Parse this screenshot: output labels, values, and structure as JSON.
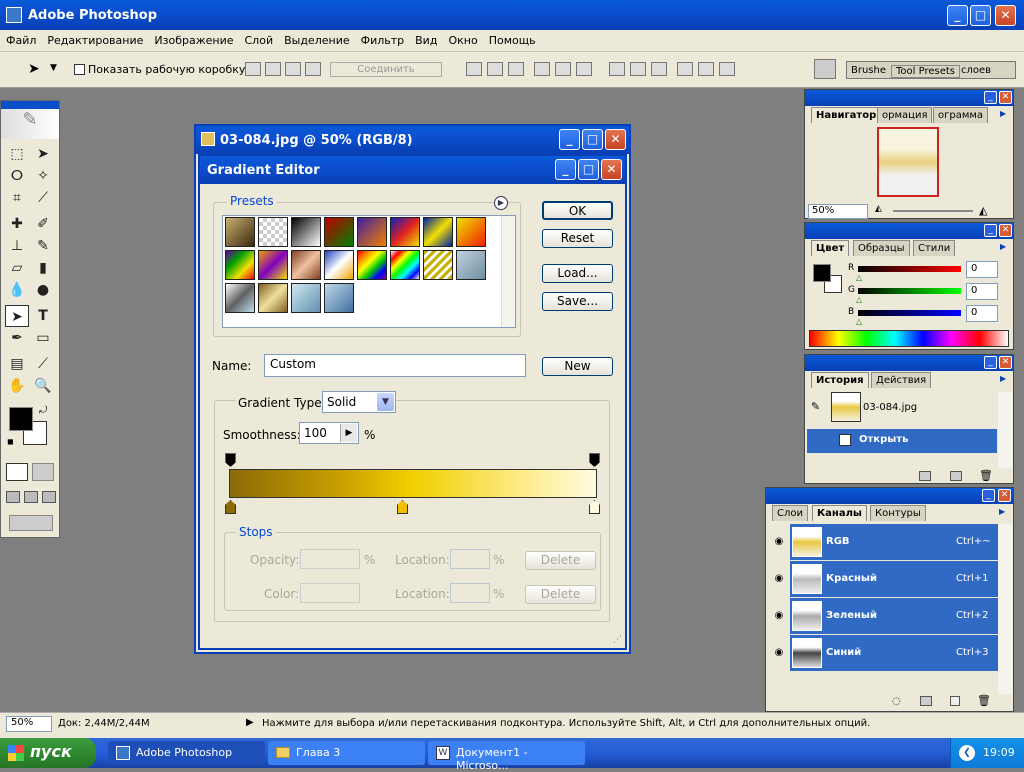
{
  "app": {
    "title": "Adobe Photoshop"
  },
  "menu": [
    "Файл",
    "Редактирование",
    "Изображение",
    "Слой",
    "Выделение",
    "Фильтр",
    "Вид",
    "Окно",
    "Помощь"
  ],
  "options": {
    "show_box_label": "Показать рабочую коробку",
    "merge_label": "Соединить",
    "palette_tabs": [
      "Brushe",
      "Tool Presets",
      "слоев"
    ]
  },
  "document": {
    "title": "03-084.jpg @ 50% (RGB/8)"
  },
  "gradient_editor": {
    "title": "Gradient Editor",
    "presets_label": "Presets",
    "buttons": {
      "ok": "OK",
      "reset": "Reset",
      "load": "Load...",
      "save": "Save...",
      "new": "New"
    },
    "name_label": "Name:",
    "name_value": "Custom",
    "type_label": "Gradient Type:",
    "type_value": "Solid",
    "smoothness_label": "Smoothness:",
    "smoothness_value": "100",
    "pct": "%",
    "stops_label": "Stops",
    "opacity_label": "Opacity:",
    "color_label": "Color:",
    "location_label": "Location:",
    "delete_label": "Delete",
    "gradient_colors": [
      "#8b6a08",
      "#c8a000",
      "#f0d000",
      "#fff0a0",
      "#fffbe0"
    ]
  },
  "navigator": {
    "tabs": [
      "Навигатор",
      "ормация",
      "ограмма"
    ],
    "zoom": "50%"
  },
  "color": {
    "tabs": [
      "Цвет",
      "Образцы",
      "Стили"
    ],
    "channels": [
      {
        "label": "R",
        "value": "0"
      },
      {
        "label": "G",
        "value": "0"
      },
      {
        "label": "B",
        "value": "0"
      }
    ]
  },
  "history": {
    "tabs": [
      "История",
      "Действия"
    ],
    "snapshot": "03-084.jpg",
    "step": "Открыть"
  },
  "channels": {
    "tabs": [
      "Слои",
      "Каналы",
      "Контуры"
    ],
    "rows": [
      {
        "name": "RGB",
        "shortcut": "Ctrl+~"
      },
      {
        "name": "Красный",
        "shortcut": "Ctrl+1"
      },
      {
        "name": "Зеленый",
        "shortcut": "Ctrl+2"
      },
      {
        "name": "Синий",
        "shortcut": "Ctrl+3"
      }
    ]
  },
  "status": {
    "zoom": "50%",
    "doc": "Док: 2,44M/2,44M",
    "hint": "Нажмите для выбора и/или перетаскивания подконтура.  Используйте Shift, Alt, и Ctrl для дополнительных опций."
  },
  "taskbar": {
    "start": "пуск",
    "tasks": [
      "Adobe Photoshop",
      "Глава 3",
      "Документ1 - Microso..."
    ],
    "time": "19:09"
  }
}
